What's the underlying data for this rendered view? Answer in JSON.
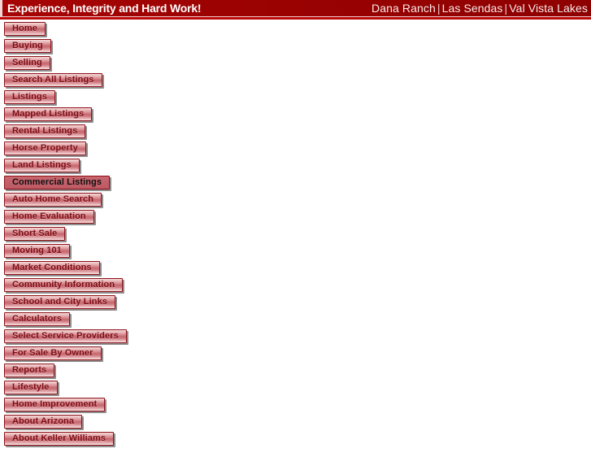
{
  "header": {
    "tagline": "Experience, Integrity and Hard Work!",
    "links": [
      {
        "label": "Dana Ranch"
      },
      {
        "label": "Las Sendas"
      },
      {
        "label": "Val Vista Lakes"
      }
    ],
    "separator": "|",
    "background_color": "#9d0202",
    "text_color": "#ffffff",
    "band_color": "#c00707"
  },
  "nav": {
    "active_item": "Commercial Listings",
    "button_text_color": "#7e0c14",
    "button_border_color": "#8d1018",
    "active_background_color": "#c2606a",
    "active_text_color": "#111111",
    "items": [
      {
        "label": "Home"
      },
      {
        "label": "Buying"
      },
      {
        "label": "Selling"
      },
      {
        "label": "Search All Listings"
      },
      {
        "label": "Listings"
      },
      {
        "label": "Mapped Listings"
      },
      {
        "label": "Rental Listings"
      },
      {
        "label": "Horse Property"
      },
      {
        "label": "Land Listings"
      },
      {
        "label": "Commercial Listings"
      },
      {
        "label": "Auto Home Search"
      },
      {
        "label": "Home Evaluation"
      },
      {
        "label": "Short Sale"
      },
      {
        "label": "Moving 101"
      },
      {
        "label": "Market Conditions"
      },
      {
        "label": "Community Information"
      },
      {
        "label": "School and City Links"
      },
      {
        "label": "Calculators"
      },
      {
        "label": "Select Service Providers"
      },
      {
        "label": "For Sale By Owner"
      },
      {
        "label": "Reports"
      },
      {
        "label": "Lifestyle"
      },
      {
        "label": "Home Improvement"
      },
      {
        "label": "About Arizona"
      },
      {
        "label": "About Keller Williams"
      }
    ]
  }
}
